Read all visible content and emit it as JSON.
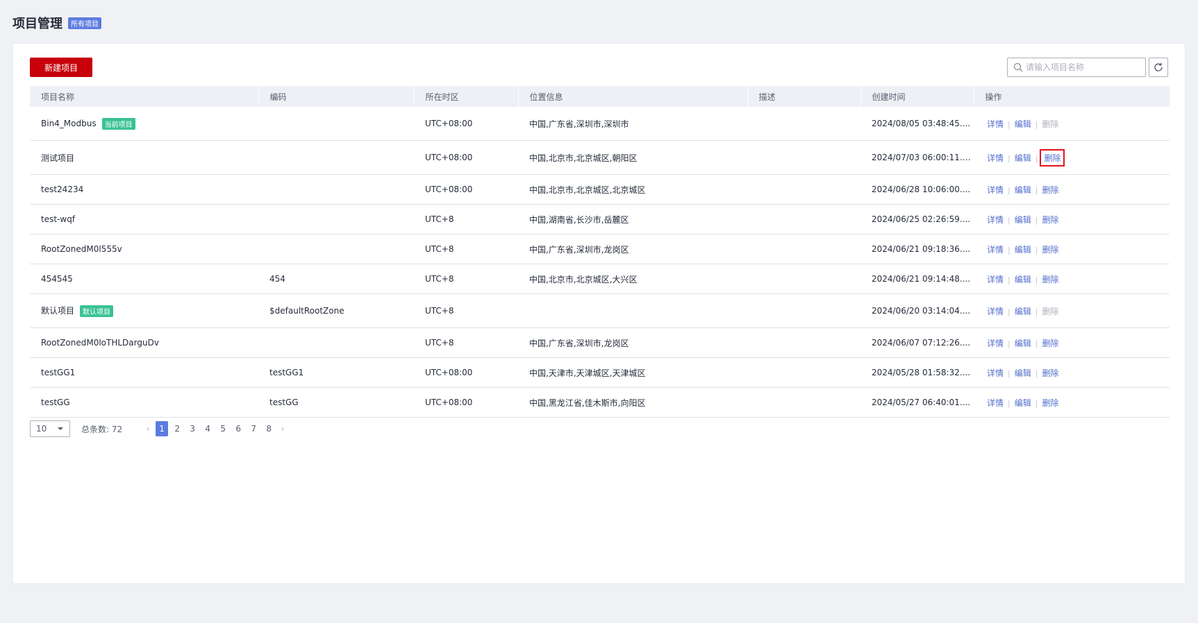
{
  "header": {
    "title": "项目管理",
    "badge": "所有项目"
  },
  "toolbar": {
    "create_label": "新建项目",
    "search_placeholder": "请输入项目名称"
  },
  "table": {
    "columns": [
      "项目名称",
      "编码",
      "所在时区",
      "位置信息",
      "描述",
      "创建时间",
      "操作"
    ],
    "rows": [
      {
        "name": "Bin4_Modbus",
        "tag": "当前项目",
        "code": "",
        "timezone": "UTC+08:00",
        "location": "中国,广东省,深圳市,深圳市",
        "description": "",
        "created": "2024/08/05 03:48:45....",
        "delete_disabled": true,
        "delete_highlighted": false
      },
      {
        "name": "测试项目",
        "tag": "",
        "code": "",
        "timezone": "UTC+08:00",
        "location": "中国,北京市,北京城区,朝阳区",
        "description": "",
        "created": "2024/07/03 06:00:11.7...",
        "delete_disabled": false,
        "delete_highlighted": true
      },
      {
        "name": "test24234",
        "tag": "",
        "code": "",
        "timezone": "UTC+08:00",
        "location": "中国,北京市,北京城区,北京城区",
        "description": "",
        "created": "2024/06/28 10:06:00....",
        "delete_disabled": false,
        "delete_highlighted": false
      },
      {
        "name": "test-wqf",
        "tag": "",
        "code": "",
        "timezone": "UTC+8",
        "location": "中国,湖南省,长沙市,岳麓区",
        "description": "",
        "created": "2024/06/25 02:26:59....",
        "delete_disabled": false,
        "delete_highlighted": false
      },
      {
        "name": "RootZonedM0l555v",
        "tag": "",
        "code": "",
        "timezone": "UTC+8",
        "location": "中国,广东省,深圳市,龙岗区",
        "description": "",
        "created": "2024/06/21 09:18:36....",
        "delete_disabled": false,
        "delete_highlighted": false
      },
      {
        "name": "454545",
        "tag": "",
        "code": "454",
        "timezone": "UTC+8",
        "location": "中国,北京市,北京城区,大兴区",
        "description": "",
        "created": "2024/06/21 09:14:48....",
        "delete_disabled": false,
        "delete_highlighted": false
      },
      {
        "name": "默认项目",
        "tag": "默认项目",
        "code": "$defaultRootZone",
        "timezone": "UTC+8",
        "location": "",
        "description": "",
        "created": "2024/06/20 03:14:04....",
        "delete_disabled": true,
        "delete_highlighted": false
      },
      {
        "name": "RootZonedM0loTHLDarguDv",
        "tag": "",
        "code": "",
        "timezone": "UTC+8",
        "location": "中国,广东省,深圳市,龙岗区",
        "description": "",
        "created": "2024/06/07 07:12:26....",
        "delete_disabled": false,
        "delete_highlighted": false
      },
      {
        "name": "testGG1",
        "tag": "",
        "code": "testGG1",
        "timezone": "UTC+08:00",
        "location": "中国,天津市,天津城区,天津城区",
        "description": "",
        "created": "2024/05/28 01:58:32....",
        "delete_disabled": false,
        "delete_highlighted": false
      },
      {
        "name": "testGG",
        "tag": "",
        "code": "testGG",
        "timezone": "UTC+08:00",
        "location": "中国,黑龙江省,佳木斯市,向阳区",
        "description": "",
        "created": "2024/05/27 06:40:01....",
        "delete_disabled": false,
        "delete_highlighted": false
      }
    ],
    "actions": {
      "detail": "详情",
      "edit": "编辑",
      "delete": "删除",
      "separator": "|"
    }
  },
  "pagination": {
    "page_size": "10",
    "total_label": "总条数: 72",
    "pages": [
      "1",
      "2",
      "3",
      "4",
      "5",
      "6",
      "7",
      "8"
    ],
    "current_page": "1",
    "prev": "‹",
    "next": "›"
  },
  "colors": {
    "primary": "#c7000b",
    "link": "#526ecc",
    "tag": "#3ac295",
    "badge": "#5e7ce0",
    "highlight_border": "#e0141a"
  },
  "icons": {
    "search": "search-icon",
    "refresh": "refresh-icon",
    "dropdown": "caret-down-icon"
  }
}
